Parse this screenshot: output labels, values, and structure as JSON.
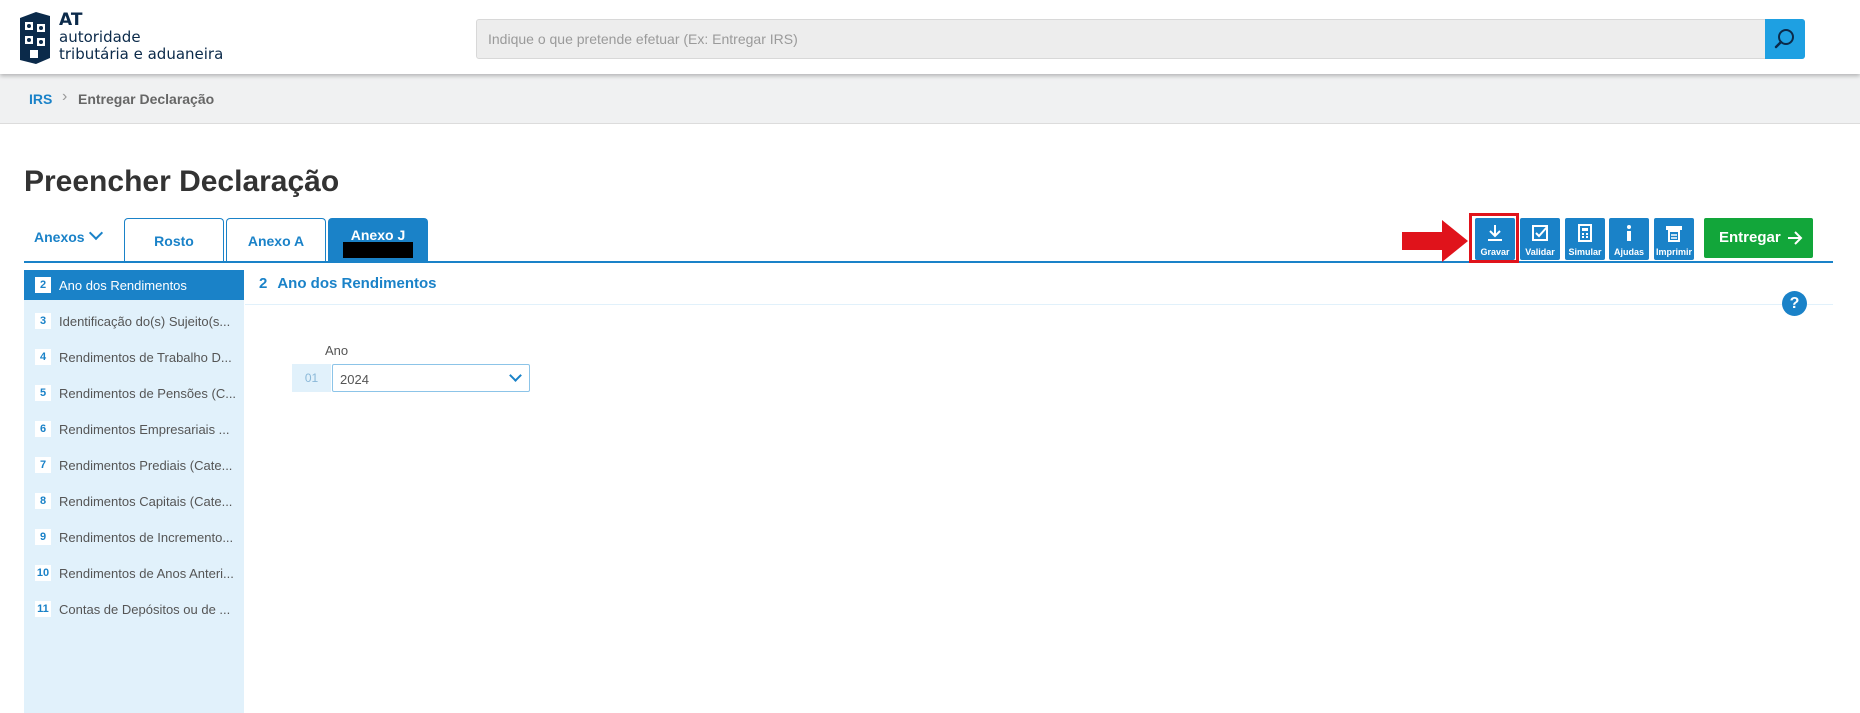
{
  "header": {
    "logo_line1": "AT",
    "logo_line2": "autoridade",
    "logo_line3": "tributária e aduaneira",
    "search_placeholder": "Indique o que pretende efetuar (Ex: Entregar IRS)",
    "search_icon": "search-icon"
  },
  "breadcrumb": {
    "home": "IRS",
    "separator": ">",
    "current": "Entregar Declaração"
  },
  "page_title": "Preencher Declaração",
  "tabs": {
    "anexos_label": "Anexos",
    "items": [
      {
        "label": "Rosto"
      },
      {
        "label": "Anexo A"
      },
      {
        "label": "Anexo J",
        "active": true
      }
    ]
  },
  "toolbar": {
    "gravar": "Gravar",
    "validar": "Validar",
    "simular": "Simular",
    "ajudas": "Ajudas",
    "imprimir": "Imprimir",
    "entregar": "Entregar"
  },
  "sidebar": {
    "items": [
      {
        "num": "2",
        "label": "Ano dos Rendimentos",
        "active": true
      },
      {
        "num": "3",
        "label": "Identificação do(s) Sujeito(s..."
      },
      {
        "num": "4",
        "label": "Rendimentos de Trabalho D..."
      },
      {
        "num": "5",
        "label": "Rendimentos de Pensões (C..."
      },
      {
        "num": "6",
        "label": "Rendimentos Empresariais ..."
      },
      {
        "num": "7",
        "label": "Rendimentos Prediais (Cate..."
      },
      {
        "num": "8",
        "label": "Rendimentos Capitais (Cate..."
      },
      {
        "num": "9",
        "label": "Rendimentos de Incremento..."
      },
      {
        "num": "10",
        "label": "Rendimentos de Anos Anteri..."
      },
      {
        "num": "11",
        "label": "Contas de Depósitos ou de ..."
      }
    ]
  },
  "section": {
    "number": "2",
    "title": "Ano dos Rendimentos",
    "help": "?",
    "field_label": "Ano",
    "field_number": "01",
    "field_value": "2024"
  },
  "colors": {
    "primary_blue": "#1a82c8",
    "search_blue": "#1ea0e2",
    "entregar_green": "#12a63a",
    "highlight_red": "#e0131b",
    "sidebar_bg": "#e1f1fb"
  }
}
